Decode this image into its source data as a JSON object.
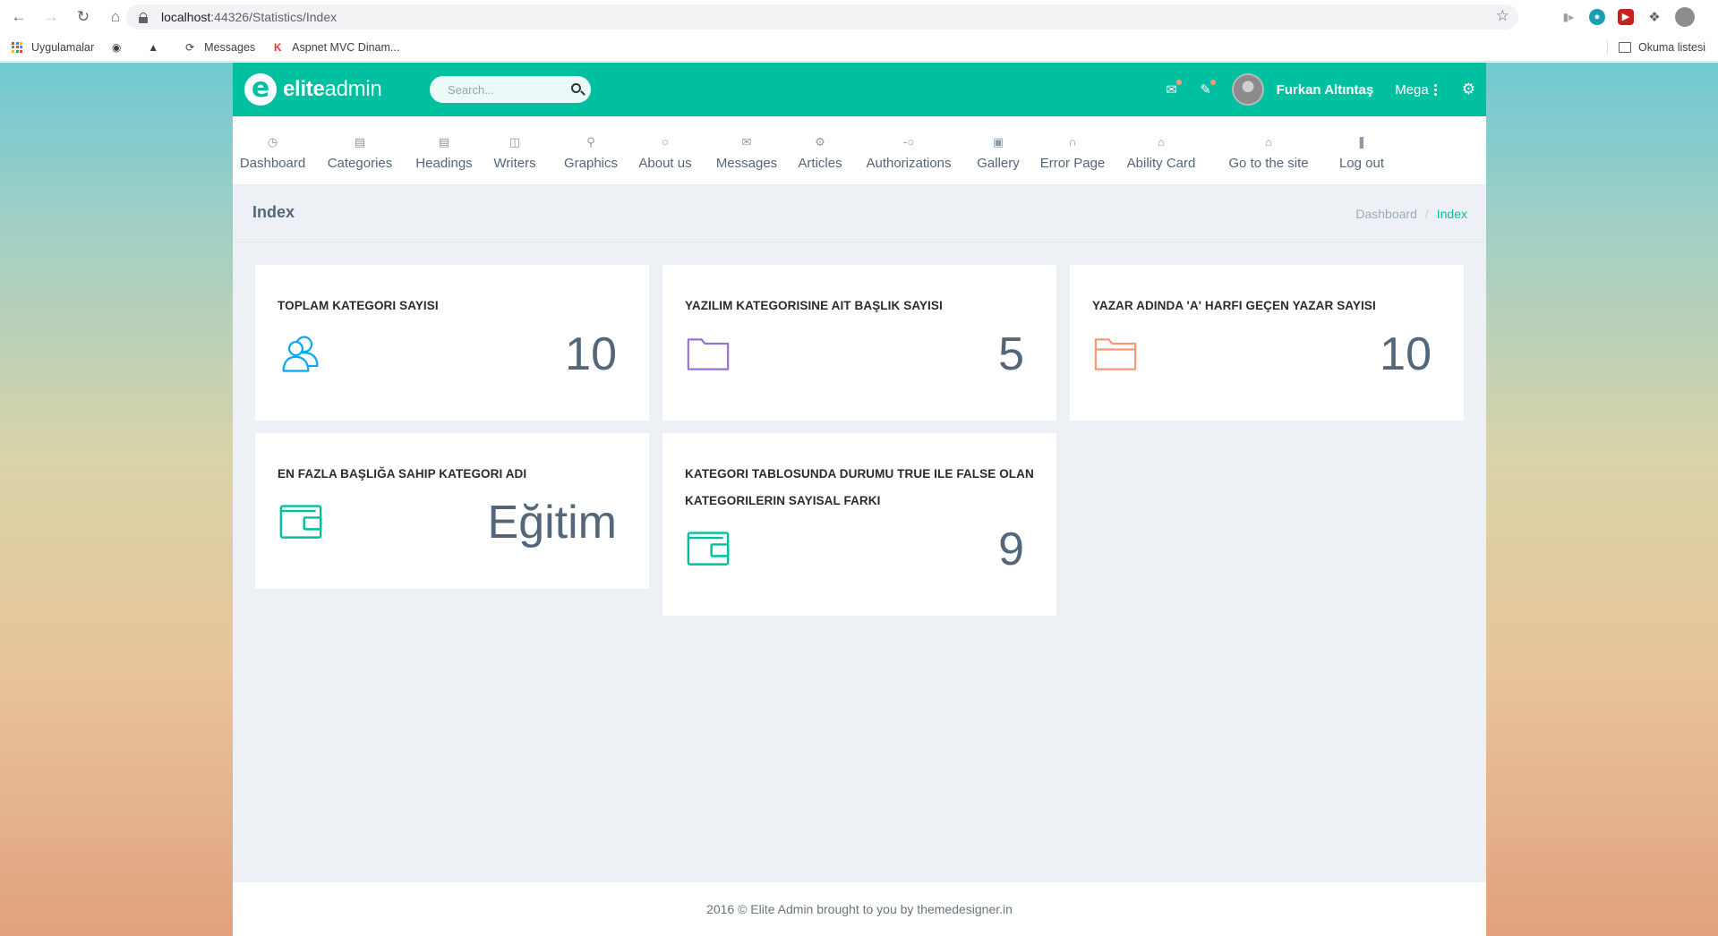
{
  "browser": {
    "url_host": "localhost",
    "url_rest": ":44326/Statistics/Index",
    "bookmarks": [
      "Uygulamalar",
      "Messages",
      "Aspnet MVC Dinam..."
    ],
    "reading_list": "Okuma listesi"
  },
  "app": {
    "logo_bold": "elite",
    "logo_light": "admin",
    "search_placeholder": "Search...",
    "user_name": "Furkan Altıntaş",
    "mega_label": "Mega",
    "accent_color": "#01c0a0",
    "menu": [
      {
        "label": "Dashboard",
        "icon": "clock-icon"
      },
      {
        "label": "Categories",
        "icon": "layout-icon"
      },
      {
        "label": "Headings",
        "icon": "layout-icon"
      },
      {
        "label": "Writers",
        "icon": "book-icon"
      },
      {
        "label": "Graphics",
        "icon": "map-pin-icon"
      },
      {
        "label": "About us",
        "icon": "bulb-icon"
      },
      {
        "label": "Messages",
        "icon": "envelope-icon"
      },
      {
        "label": "Articles",
        "icon": "gear-icon"
      },
      {
        "label": "Authorizations",
        "icon": "key-icon"
      },
      {
        "label": "Gallery",
        "icon": "gallery-icon"
      },
      {
        "label": "Error Page",
        "icon": "headset-icon"
      },
      {
        "label": "Ability Card",
        "icon": "home-icon"
      },
      {
        "label": "Go to the site",
        "icon": "home-icon"
      },
      {
        "label": "Log out",
        "icon": "logout-icon"
      }
    ],
    "page_title": "Index",
    "breadcrumb": [
      "Dashboard",
      "Index"
    ],
    "cards": [
      {
        "title": "TOPLAM KATEGORI SAYISI",
        "value": "10",
        "icon": "users-icon",
        "color": "#03a9f3"
      },
      {
        "title": "YAZILIM KATEGORISINE AIT BAŞLIK SAYISI",
        "value": "5",
        "icon": "folder-icon",
        "color": "#9675ce"
      },
      {
        "title": "YAZAR ADINDA 'A' HARFI GEÇEN YAZAR SAYISI",
        "value": "10",
        "icon": "folder-open-icon",
        "color": "#fb9678"
      },
      {
        "title": "EN FAZLA BAŞLIĞA SAHIP KATEGORI ADI",
        "value": "Eğitim",
        "icon": "wallet-icon",
        "color": "#01c0a0"
      },
      {
        "title": "KATEGORI TABLOSUNDA DURUMU TRUE ILE FALSE OLAN KATEGORILERIN SAYISAL FARKI",
        "value": "9",
        "icon": "wallet-icon",
        "color": "#01c0a0"
      }
    ],
    "footer": "2016 © Elite Admin brought to you by themedesigner.in"
  }
}
